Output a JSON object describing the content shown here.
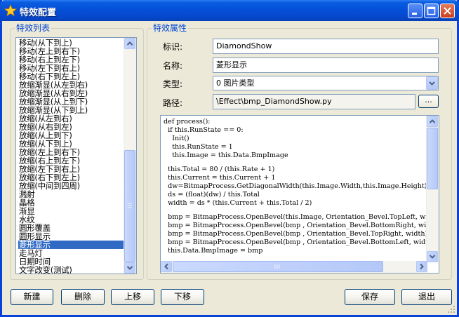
{
  "window": {
    "title": "特效配置"
  },
  "left_panel": {
    "group_label": "特效列表",
    "items": [
      "移动(从下到上)",
      "移动(左上到右下)",
      "移动(右上到左下)",
      "移动(左下到右上)",
      "移动(右下到左上)",
      "放缩渐显(从左到右)",
      "放缩渐显(从右到左)",
      "放缩渐显(从上到下)",
      "放缩渐显(从下到上)",
      "放缩(从左到右)",
      "放缩(从右到左)",
      "放缩(从上到下)",
      "放缩(从下到上)",
      "放缩(左上到右下)",
      "放缩(右上到左下)",
      "放缩(左下到右上)",
      "放缩(右下到左上)",
      "放缩(中间到四周)",
      "溅射",
      "晶格",
      "渐显",
      "水纹",
      "圆形覆盖",
      "圆形显示",
      "菱形显示",
      "走马灯",
      "日期时间",
      "文字改变(测试)"
    ],
    "selected_index": 24
  },
  "right_panel": {
    "group_label": "特效属性",
    "id_label": "标识:",
    "id_value": "DiamondShow",
    "name_label": "名称:",
    "name_value": "菱形显示",
    "type_label": "类型:",
    "type_value": "0 图片类型",
    "path_label": "路径:",
    "path_value": "\\Effect\\bmp_DiamondShow.py",
    "browse_label": "...",
    "code_lines": [
      "def process():",
      "  if this.RunState == 0:",
      "    Init()",
      "    this.RunState = 1",
      "    this.Image = this.Data.BmpImage",
      "",
      "  this.Total = 80 / (this.Rate + 1)",
      "  this.Current = this.Current + 1",
      "  dw=BitmapProcess.GetDiagonalWidth(this.Image.Width,this.Image.Height)",
      "  ds = (float)(dw) / this.Total",
      "  width = ds * (this.Current + this.Total / 2)",
      "",
      "  bmp = BitmapProcess.OpenBevel(this.Image, Orientation_Bevel.TopLeft, width)",
      "  bmp = BitmapProcess.OpenBevel(bmp , Orientation_Bevel.BottomRight, width)",
      "  bmp = BitmapProcess.OpenBevel(bmp , Orientation_Bevel.TopRight, width)",
      "  bmp = BitmapProcess.OpenBevel(bmp , Orientation_Bevel.BottomLeft, width)",
      "  this.Data.BmpImage = bmp"
    ]
  },
  "buttons": {
    "new": "新建",
    "delete": "删除",
    "move_up": "上移",
    "move_down": "下移",
    "save": "保存",
    "exit": "退出"
  }
}
